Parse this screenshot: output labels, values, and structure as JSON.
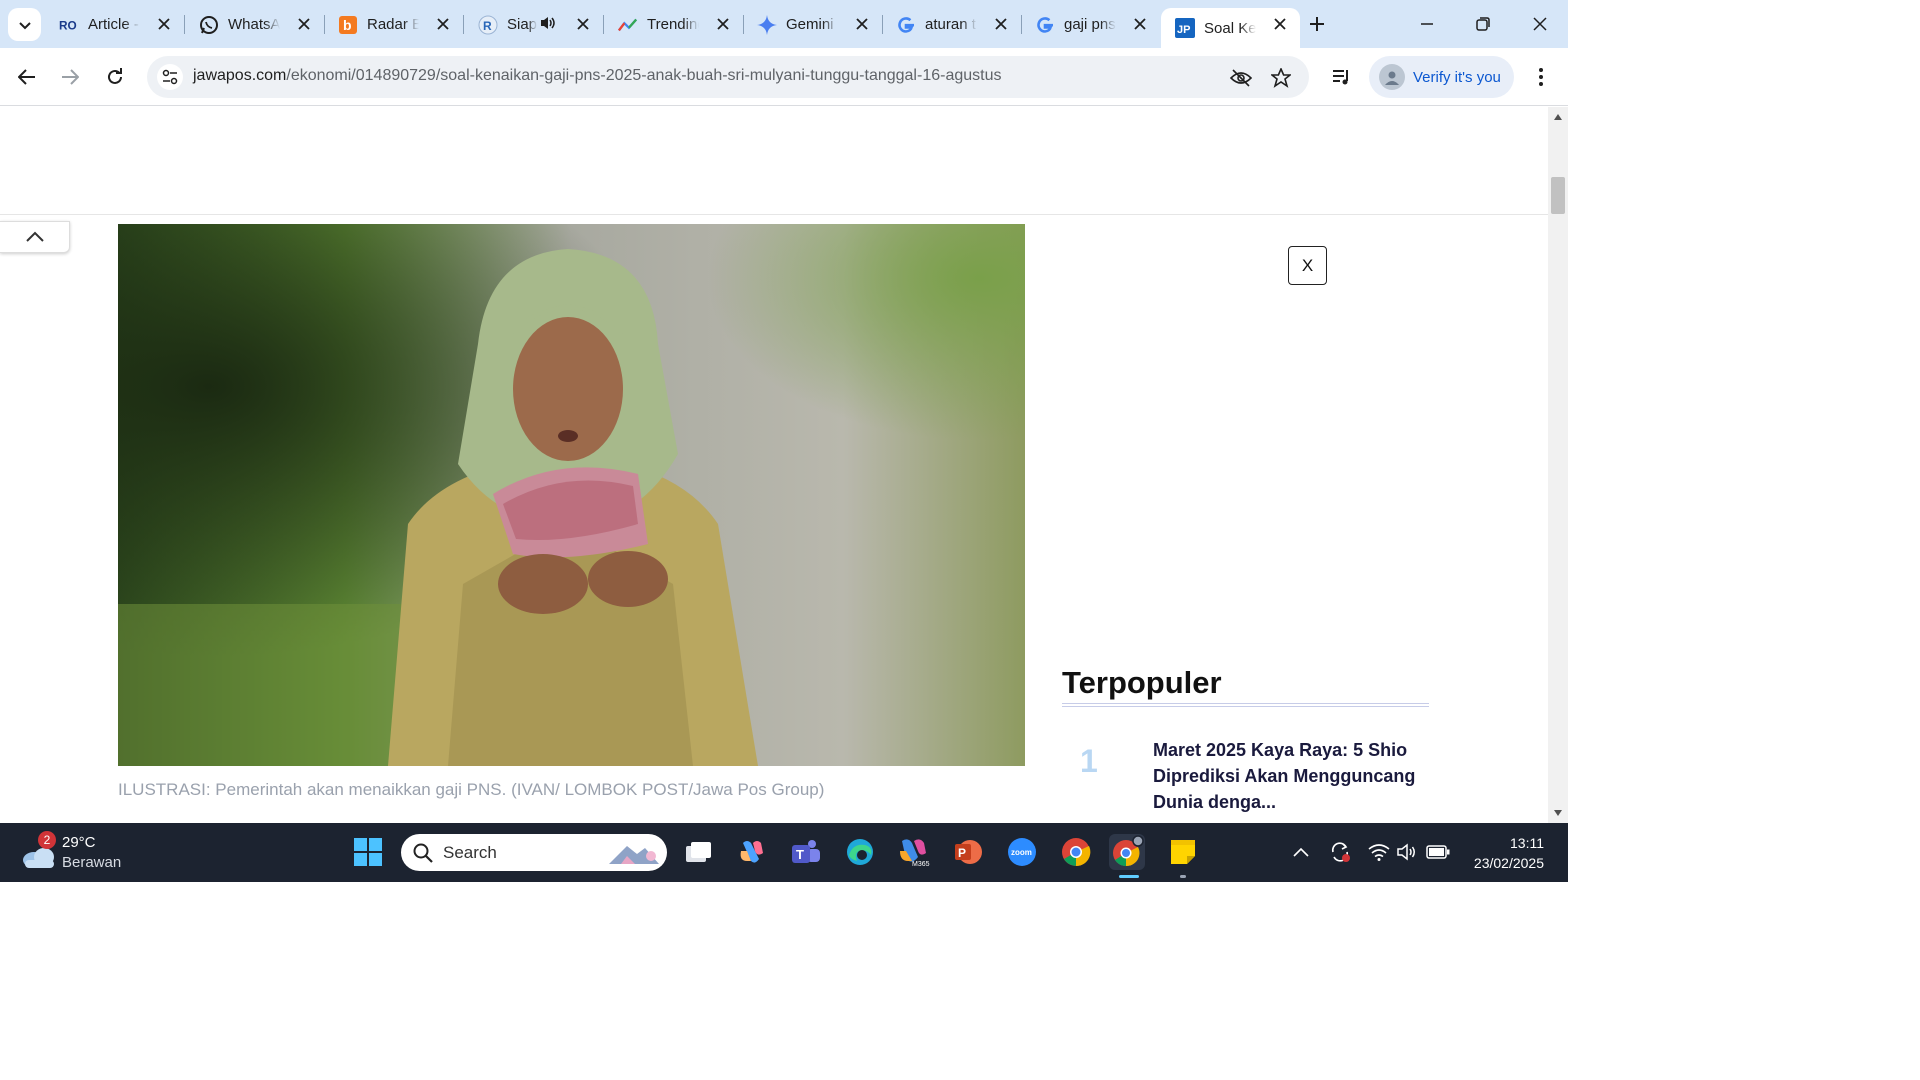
{
  "tabs": [
    {
      "title": "Article -",
      "favicon": "ro-logo-icon"
    },
    {
      "title": "WhatsApp",
      "favicon": "whatsapp-icon"
    },
    {
      "title": "Radar Bogor",
      "favicon": "radar-logo-icon"
    },
    {
      "title": "Siap",
      "favicon": "r-logo-icon",
      "audio": true
    },
    {
      "title": "Trending",
      "favicon": "trending-icon"
    },
    {
      "title": "Gemini",
      "favicon": "gemini-icon"
    },
    {
      "title": "aturan t",
      "favicon": "google-icon"
    },
    {
      "title": "gaji pns",
      "favicon": "google-icon"
    },
    {
      "title": "Soal Ker",
      "favicon": "jp-logo-icon",
      "active": true
    }
  ],
  "address": {
    "host": "jawapos.com",
    "path": "/ekonomi/014890729/soal-kenaikan-gaji-pns-2025-anak-buah-sri-mulyani-tunggu-tanggal-16-agustus"
  },
  "profile": {
    "label": "Verify it's you"
  },
  "article": {
    "caption": "ILUSTRASI: Pemerintah akan menaikkan gaji PNS. (IVAN/ LOMBOK POST/Jawa Pos Group)"
  },
  "sidebar": {
    "close_ad": "X",
    "popular_title": "Terpopuler",
    "items": [
      {
        "rank": "1",
        "title": "Maret 2025 Kaya Raya: 5 Shio Diprediksi Akan Mengguncang Dunia denga..."
      }
    ]
  },
  "taskbar": {
    "weather_temp": "29°C",
    "weather_cond": "Berawan",
    "weather_badge": "2",
    "search_label": "Search",
    "time": "13:11",
    "date": "23/02/2025"
  },
  "colors": {
    "tabstrip": "#d6e6f8",
    "accent": "#0b57d0",
    "popular_rank": "#b9d7f3",
    "taskbar": "#1c2330"
  }
}
